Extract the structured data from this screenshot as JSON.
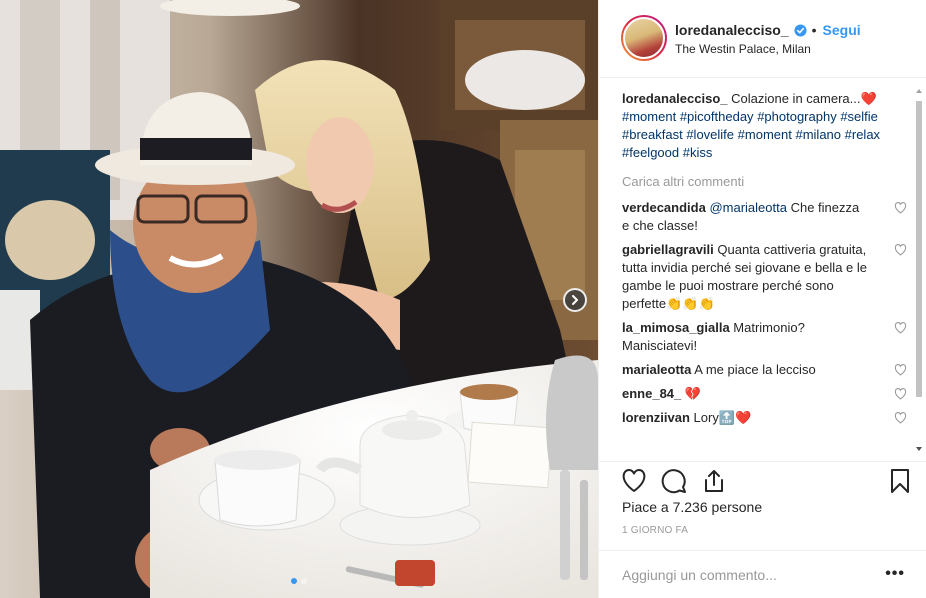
{
  "post": {
    "username": "loredanalecciso_",
    "follow_label": "Segui",
    "separator": "•",
    "location": "The Westin Palace, Milan",
    "caption": {
      "username": "loredanalecciso_",
      "text": "Colazione in camera...",
      "emoji": "❤️",
      "hashtags": [
        "#moment",
        "#picoftheday",
        "#photography",
        "#selfie",
        "#breakfast",
        "#lovelife",
        "#moment",
        "#milano",
        "#relax",
        "#feelgood",
        "#kiss"
      ]
    },
    "load_more_label": "Carica altri commenti",
    "comments": [
      {
        "username": "verdecandida",
        "mention": "@marialeotta",
        "text": "Che finezza e che classe!"
      },
      {
        "username": "gabriellagravili",
        "text": "Quanta cattiveria gratuita, tutta invidia perché sei giovane e bella e le gambe le puoi mostrare perché sono perfette",
        "emoji": "👏👏👏"
      },
      {
        "username": "la_mimosa_gialla",
        "text": "Matrimonio? Manisciatevi!"
      },
      {
        "username": "marialeotta",
        "text": "A me piace la lecciso"
      },
      {
        "username": "enne_84_",
        "emoji": "💔"
      },
      {
        "username": "lorenziivan",
        "text": "Lory",
        "emoji": "🔝❤️"
      }
    ],
    "likes_label": "Piace a 7.236 persone",
    "time_label": "1 GIORNO FA",
    "add_comment_placeholder": "Aggiungi un commento...",
    "more_options_label": "•••",
    "carousel": {
      "slide_count": 2,
      "active_index": 0
    }
  },
  "colors": {
    "link": "#3897f0",
    "hashtag": "#003569",
    "muted": "#999999",
    "text": "#262626",
    "border": "#efefef",
    "heart_red": "#ed4956"
  },
  "icons": [
    "verified-badge-icon",
    "heart-icon",
    "comment-icon",
    "share-icon",
    "bookmark-icon",
    "chevron-right-icon"
  ]
}
